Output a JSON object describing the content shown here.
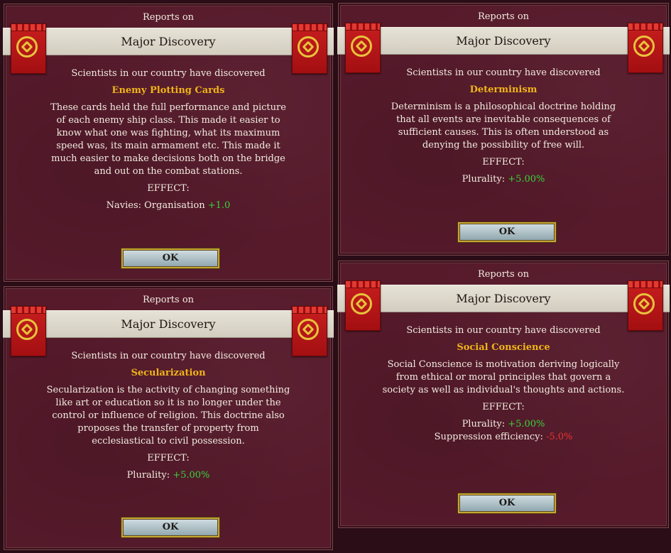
{
  "reports": [
    {
      "reports_on": "Reports on",
      "title": "Major Discovery",
      "intro": "Scientists in our country have discovered",
      "name": "Enemy Plotting Cards",
      "description": "These cards held the full performance and picture of each enemy ship class. This made it easier to know what one was fighting, what its maximum speed was, its main armament etc. This made it much easier to make decisions both on the bridge and out on the combat stations.",
      "effect_label": "EFFECT:",
      "effects": [
        {
          "label": "Navies: Organisation",
          "value": "+1.0",
          "sign": "positive"
        }
      ],
      "ok_label": "OK"
    },
    {
      "reports_on": "Reports on",
      "title": "Major Discovery",
      "intro": "Scientists in our country have discovered",
      "name": "Determinism",
      "description": "Determinism is a philosophical doctrine holding that all events are inevitable consequences of sufficient causes. This is often understood as denying the possibility of free will.",
      "effect_label": "EFFECT:",
      "effects": [
        {
          "label": "Plurality:",
          "value": "+5.00%",
          "sign": "positive"
        }
      ],
      "ok_label": "OK"
    },
    {
      "reports_on": "Reports on",
      "title": "Major Discovery",
      "intro": "Scientists in our country have discovered",
      "name": "Secularization",
      "description": "Secularization is the activity of changing something like art or education so it is no longer under the control or influence of religion. This doctrine also proposes the transfer of property from ecclesiastical to civil possession.",
      "effect_label": "EFFECT:",
      "effects": [
        {
          "label": "Plurality:",
          "value": "+5.00%",
          "sign": "positive"
        }
      ],
      "ok_label": "OK"
    },
    {
      "reports_on": "Reports on",
      "title": "Major Discovery",
      "intro": "Scientists in our country have discovered",
      "name": "Social Conscience",
      "description": "Social Conscience is motivation deriving logically from ethical or moral principles that govern a society as well as individual's thoughts and actions.",
      "effect_label": "EFFECT:",
      "effects": [
        {
          "label": "Plurality:",
          "value": "+5.00%",
          "sign": "positive"
        },
        {
          "label": "Suppression efficiency:",
          "value": "-5.0%",
          "sign": "negative"
        }
      ],
      "ok_label": "OK"
    }
  ],
  "colors": {
    "panel": "#561a2b",
    "banner": "#e0dcd0",
    "tech_name": "#f0b418",
    "positive": "#39d43a",
    "negative": "#ec3232",
    "flag": "#c81e1e",
    "emblem": "#e8c23c"
  },
  "icons": {
    "flag": "red-banner-gold-wreath-emblem"
  }
}
